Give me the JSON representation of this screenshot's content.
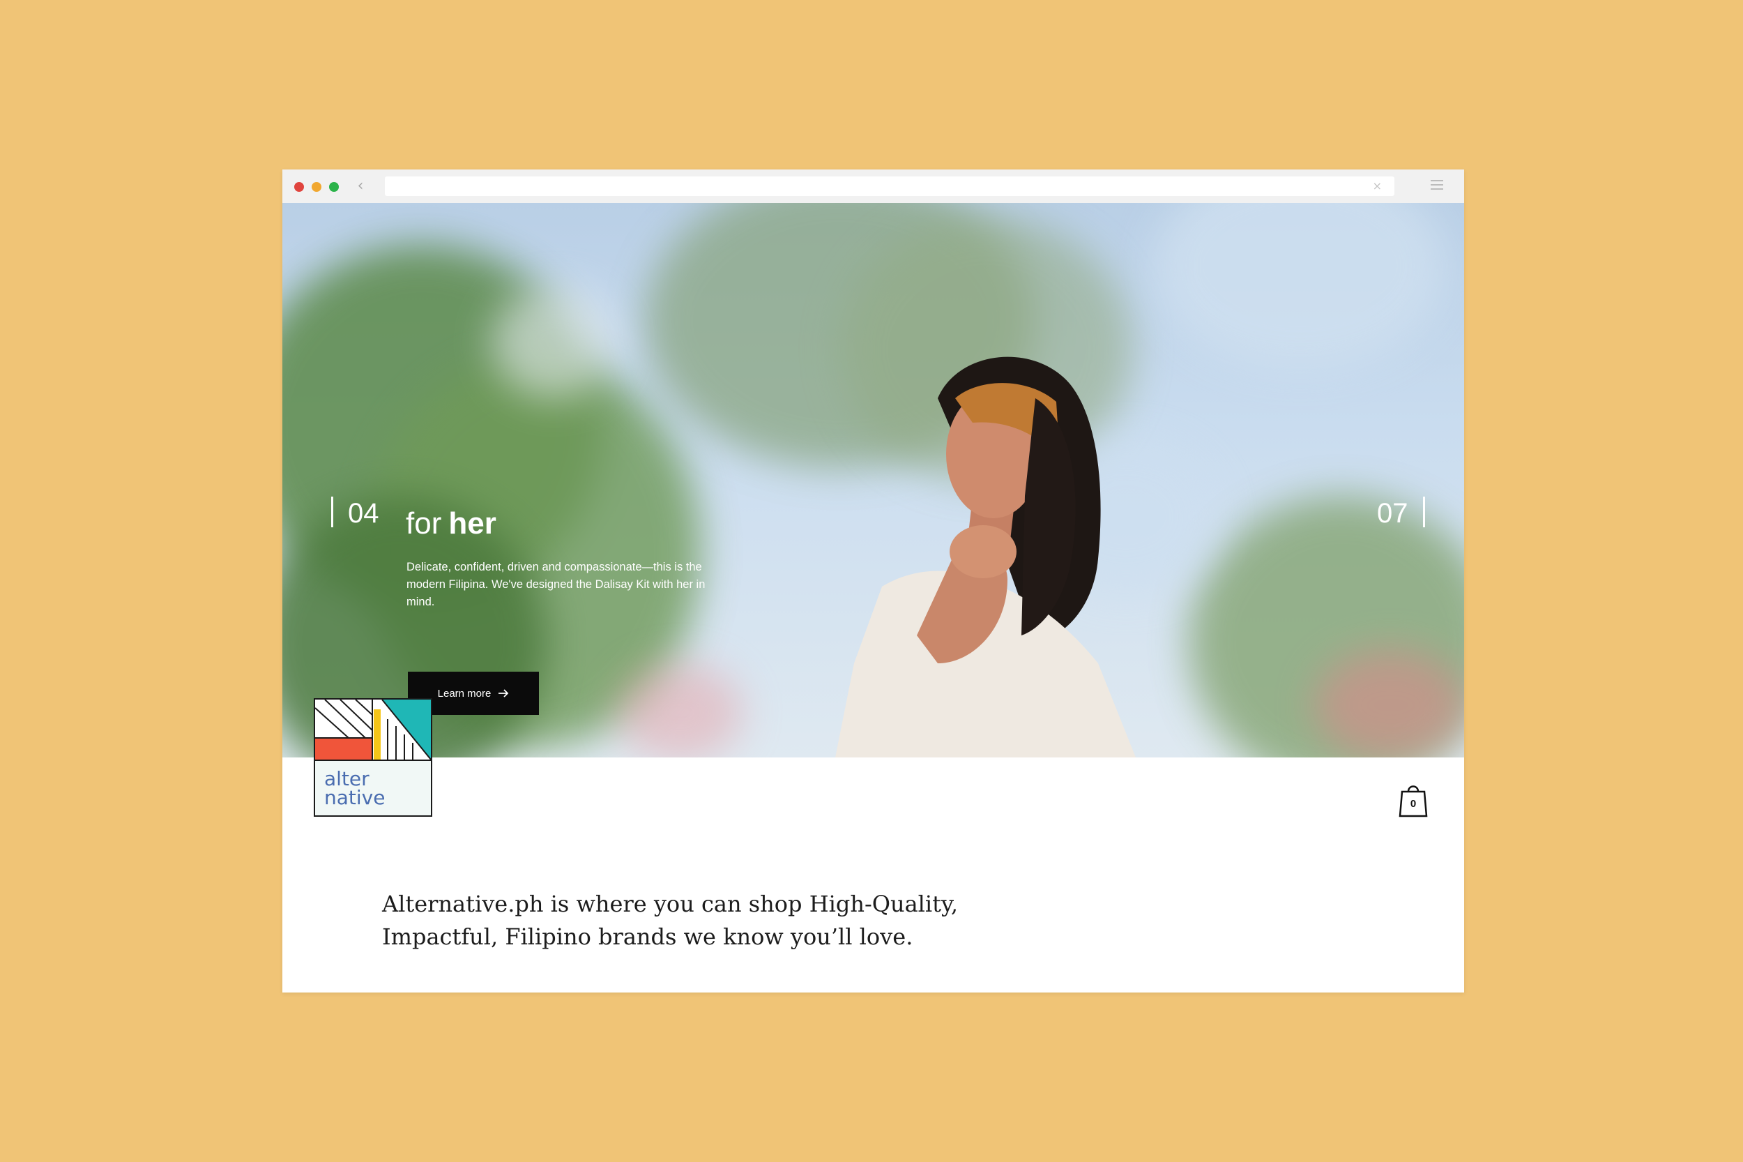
{
  "browser": {
    "back_icon": "chevron-left-icon",
    "url_value": "",
    "clear_icon_glyph": "×",
    "menu_icon": "hamburger-icon"
  },
  "hero": {
    "slide_current": "04",
    "slide_total": "07",
    "title_light": "for",
    "title_bold": "her",
    "description": "Delicate, confident, driven and compassionate—this is the modern Filipina. We've designed the Dalisay Kit with her in mind.",
    "cta_label": "Learn more",
    "cta_icon": "arrow-right-icon"
  },
  "logo": {
    "line1": "alter",
    "line2": "native",
    "colors": {
      "coral": "#f0553a",
      "yellow": "#f5c518",
      "teal": "#1fb7b6",
      "text": "#4a6db0",
      "box_bg": "#f1f8f6"
    }
  },
  "cart": {
    "icon": "shopping-bag-icon",
    "count": "0"
  },
  "tagline": {
    "line1": "Alternative.ph is where you can shop High-Quality,",
    "line2": "Impactful, Filipino brands we know you’ll love."
  },
  "colors": {
    "page_background": "#f0c476",
    "cta_background": "#0b0b0b"
  }
}
